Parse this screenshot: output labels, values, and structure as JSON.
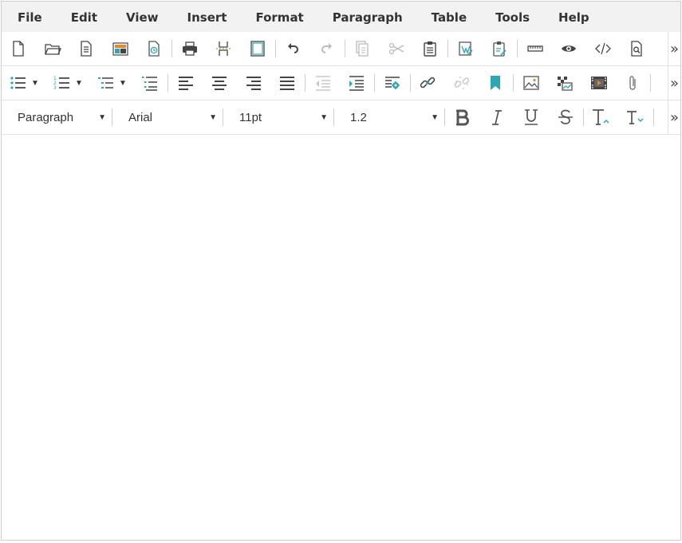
{
  "menu": [
    "File",
    "Edit",
    "View",
    "Insert",
    "Format",
    "Paragraph",
    "Table",
    "Tools",
    "Help"
  ],
  "toolbar1": {
    "buttons": [
      "new-document",
      "open-folder",
      "document-template",
      "layout-template",
      "restore-draft",
      "print",
      "page-break",
      "fullscreen",
      "undo",
      "redo",
      "copy",
      "cut",
      "paste",
      "paste-from-word",
      "paste-as-text",
      "ruler",
      "preview",
      "source-code",
      "find-replace"
    ]
  },
  "toolbar2": {
    "buttons": [
      "bulleted-list",
      "numbered-list",
      "multilevel-list",
      "table-of-contents",
      "align-left",
      "align-center",
      "align-right",
      "justify",
      "outdent",
      "indent",
      "insert-special",
      "link",
      "unlink",
      "bookmark",
      "image",
      "insert-map",
      "video",
      "attachment"
    ]
  },
  "format": {
    "block": "Paragraph",
    "font": "Arial",
    "size": "11pt",
    "line_height": "1.2"
  },
  "more_label": "»",
  "colors": {
    "accent": "#2aa8b5",
    "icon": "#555555",
    "disabled": "#bbbbbb"
  }
}
